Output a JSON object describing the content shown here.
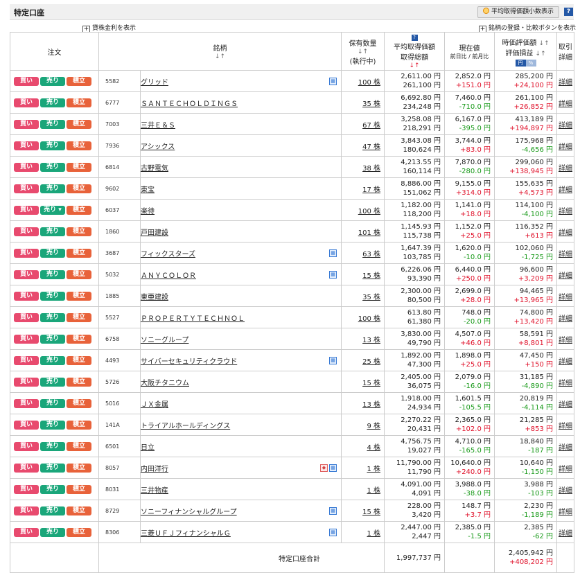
{
  "header": {
    "title": "特定口座",
    "decimal_toggle": "平均取得価額小数表示",
    "help": "?"
  },
  "links": {
    "lending": "貸株金利を表示",
    "compare": "銘柄の登録・比較ボタンを表示",
    "plus": "+"
  },
  "columns": {
    "order": "注文",
    "name": "銘柄",
    "qty_l1": "保有数量",
    "qty_l2": "(執行中)",
    "avg_help": "?",
    "avg_l1": "平均取得価額",
    "avg_l2": "取得総額",
    "cur_l1": "現在値",
    "cur_l2": "前日比 / 前月比",
    "val_l1": "時価評価額",
    "val_l2": "評価損益",
    "yen": "円",
    "pct": "%",
    "det_l1": "取引",
    "det_l2": "詳細",
    "sort": "↓↑"
  },
  "buttons": {
    "buy": "買い",
    "sell": "売り",
    "sell_menu": "売り ▾",
    "tsumitate": "積立",
    "detail": "詳細"
  },
  "rows": [
    {
      "code": "5582",
      "name": "グリッド",
      "qty": "100 株",
      "avg": "2,611.00 円",
      "cost": "261,100 円",
      "price": "2,852.0 円",
      "change": "+151.0 円",
      "value": "285,200 円",
      "pl": "+24,100 円"
    },
    {
      "code": "6777",
      "name": "ＳＡＮＴＥＣＨＯＬＤＩＮＧＳ",
      "qty": "35 株",
      "avg": "6,692.80 円",
      "cost": "234,248 円",
      "price": "7,460.0 円",
      "change": "-710.0 円",
      "value": "261,100 円",
      "pl": "+26,852 円"
    },
    {
      "code": "7003",
      "name": "三井Ｅ＆Ｓ",
      "qty": "67 株",
      "avg": "3,258.08 円",
      "cost": "218,291 円",
      "price": "6,167.0 円",
      "change": "-395.0 円",
      "value": "413,189 円",
      "pl": "+194,897 円"
    },
    {
      "code": "7936",
      "name": "アシックス",
      "qty": "47 株",
      "avg": "3,843.08 円",
      "cost": "180,624 円",
      "price": "3,744.0 円",
      "change": "+83.0 円",
      "value": "175,968 円",
      "pl": "-4,656 円"
    },
    {
      "code": "6814",
      "name": "古野電気",
      "qty": "38 株",
      "avg": "4,213.55 円",
      "cost": "160,114 円",
      "price": "7,870.0 円",
      "change": "-280.0 円",
      "value": "299,060 円",
      "pl": "+138,945 円"
    },
    {
      "code": "9602",
      "name": "東宝",
      "qty": "17 株",
      "avg": "8,886.00 円",
      "cost": "151,062 円",
      "price": "9,155.0 円",
      "change": "+314.0 円",
      "value": "155,635 円",
      "pl": "+4,573 円"
    },
    {
      "code": "6037",
      "name": "楽待",
      "qty": "100 株",
      "avg": "1,182.00 円",
      "cost": "118,200 円",
      "price": "1,141.0 円",
      "change": "+18.0 円",
      "value": "114,100 円",
      "pl": "-4,100 円"
    },
    {
      "code": "1860",
      "name": "戸田建設",
      "qty": "101 株",
      "avg": "1,145.93 円",
      "cost": "115,738 円",
      "price": "1,152.0 円",
      "change": "+25.0 円",
      "value": "116,352 円",
      "pl": "+613 円"
    },
    {
      "code": "3687",
      "name": "フィックスターズ",
      "qty": "63 株",
      "avg": "1,647.39 円",
      "cost": "103,785 円",
      "price": "1,620.0 円",
      "change": "-10.0 円",
      "value": "102,060 円",
      "pl": "-1,725 円"
    },
    {
      "code": "5032",
      "name": "ＡＮＹＣＯＬＯＲ",
      "qty": "15 株",
      "avg": "6,226.06 円",
      "cost": "93,390 円",
      "price": "6,440.0 円",
      "change": "+250.0 円",
      "value": "96,600 円",
      "pl": "+3,209 円"
    },
    {
      "code": "1885",
      "name": "東亜建設",
      "qty": "35 株",
      "avg": "2,300.00 円",
      "cost": "80,500 円",
      "price": "2,699.0 円",
      "change": "+28.0 円",
      "value": "94,465 円",
      "pl": "+13,965 円"
    },
    {
      "code": "5527",
      "name": "ＰＲＯＰＥＲＴＹＴＥＣＨＮＯＬ",
      "qty": "100 株",
      "avg": "613.80 円",
      "cost": "61,380 円",
      "price": "748.0 円",
      "change": "-20.0 円",
      "value": "74,800 円",
      "pl": "+13,420 円"
    },
    {
      "code": "6758",
      "name": "ソニーグループ",
      "qty": "13 株",
      "avg": "3,830.00 円",
      "cost": "49,790 円",
      "price": "4,507.0 円",
      "change": "+46.0 円",
      "value": "58,591 円",
      "pl": "+8,801 円"
    },
    {
      "code": "4493",
      "name": "サイバーセキュリティクラウド",
      "qty": "25 株",
      "avg": "1,892.00 円",
      "cost": "47,300 円",
      "price": "1,898.0 円",
      "change": "+25.0 円",
      "value": "47,450 円",
      "pl": "+150 円"
    },
    {
      "code": "5726",
      "name": "大阪チタニウム",
      "qty": "15 株",
      "avg": "2,405.00 円",
      "cost": "36,075 円",
      "price": "2,079.0 円",
      "change": "-16.0 円",
      "value": "31,185 円",
      "pl": "-4,890 円"
    },
    {
      "code": "5016",
      "name": "ＪＸ金属",
      "qty": "13 株",
      "avg": "1,918.00 円",
      "cost": "24,934 円",
      "price": "1,601.5 円",
      "change": "-105.5 円",
      "value": "20,819 円",
      "pl": "-4,114 円"
    },
    {
      "code": "141A",
      "name": "トライアルホールディングス",
      "qty": "9 株",
      "avg": "2,270.22 円",
      "cost": "20,431 円",
      "price": "2,365.0 円",
      "change": "+102.0 円",
      "value": "21,285 円",
      "pl": "+853 円"
    },
    {
      "code": "6501",
      "name": "日立",
      "qty": "4 株",
      "avg": "4,756.75 円",
      "cost": "19,027 円",
      "price": "4,710.0 円",
      "change": "-165.0 円",
      "value": "18,840 円",
      "pl": "-187 円"
    },
    {
      "code": "8057",
      "name": "内田洋行",
      "qty": "1 株",
      "avg": "11,790.00 円",
      "cost": "11,790 円",
      "price": "10,640.0 円",
      "change": "+240.0 円",
      "value": "10,640 円",
      "pl": "-1,150 円"
    },
    {
      "code": "8031",
      "name": "三井物産",
      "qty": "1 株",
      "avg": "4,091.00 円",
      "cost": "4,091 円",
      "price": "3,988.0 円",
      "change": "-38.0 円",
      "value": "3,988 円",
      "pl": "-103 円"
    },
    {
      "code": "8729",
      "name": "ソニーフィナンシャルグループ",
      "qty": "15 株",
      "avg": "228.00 円",
      "cost": "3,420 円",
      "price": "148.7 円",
      "change": "+3.7 円",
      "value": "2,230 円",
      "pl": "-1,189 円"
    },
    {
      "code": "8306",
      "name": "三菱ＵＦＪフィナンシャルＧ",
      "qty": "1 株",
      "avg": "2,447.00 円",
      "cost": "2,447 円",
      "price": "2,385.0 円",
      "change": "-1.5 円",
      "value": "2,385 円",
      "pl": "-62 円"
    }
  ],
  "row_flags": [
    {
      "cal": true
    },
    {
      "cal": false
    },
    {
      "cal": false
    },
    {
      "cal": false
    },
    {
      "cal": false
    },
    {
      "cal": false
    },
    {
      "cal": false,
      "sell_menu": true
    },
    {
      "cal": false
    },
    {
      "cal": true
    },
    {
      "cal": true
    },
    {
      "cal": false
    },
    {
      "cal": false
    },
    {
      "cal": false
    },
    {
      "cal": true
    },
    {
      "cal": false
    },
    {
      "cal": false
    },
    {
      "cal": false
    },
    {
      "cal": false
    },
    {
      "cal": true,
      "event": true
    },
    {
      "cal": false
    },
    {
      "cal": true
    },
    {
      "cal": true
    }
  ],
  "total": {
    "label": "特定口座合計",
    "cost": "1,997,737 円",
    "value": "2,405,942 円",
    "pl": "+408,202 円"
  },
  "colors": {
    "buy": "#e84a6e",
    "sell": "#1aa67a",
    "tsumitate": "#e8623a",
    "positive": "#e0112a",
    "negative": "#199a1a"
  }
}
